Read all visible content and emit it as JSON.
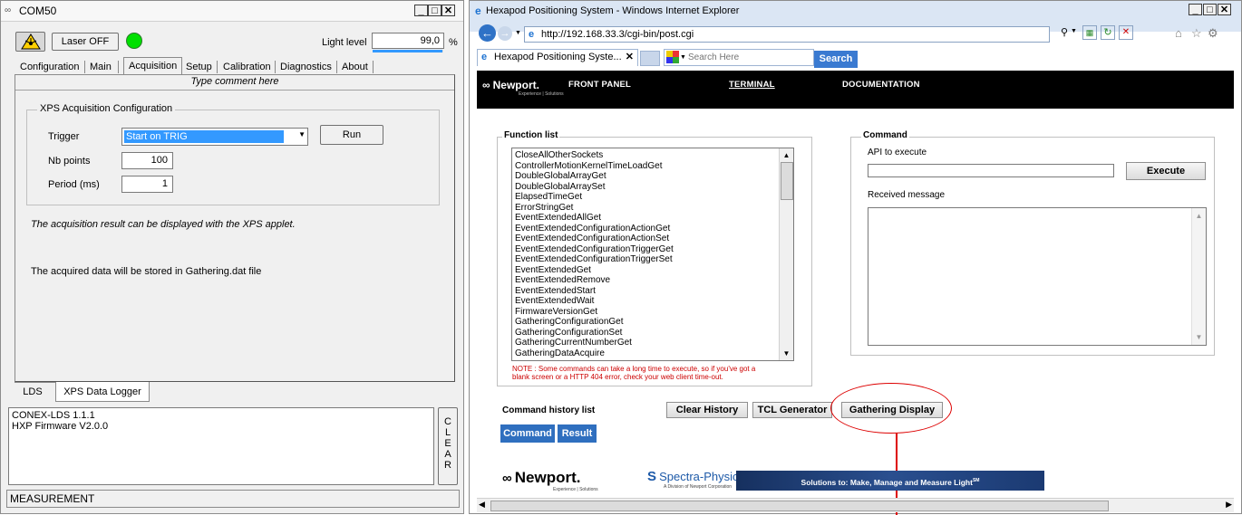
{
  "left": {
    "title": "COM50",
    "laser_button": "Laser OFF",
    "light_level_label": "Light level",
    "light_level_value": "99,0",
    "light_level_unit": "%",
    "tabs": [
      "Configuration",
      "Main",
      "Acquisition",
      "Setup",
      "Calibration",
      "Diagnostics",
      "About"
    ],
    "active_tab": "Acquisition",
    "comment": "Type comment here",
    "group_title": "XPS Acquisition Configuration",
    "trigger_label": "Trigger",
    "trigger_value": "Start on TRIG",
    "run_button": "Run",
    "nb_points_label": "Nb points",
    "nb_points_value": "100",
    "period_label": "Period (ms)",
    "period_value": "1",
    "note1": "The acquisition result can be displayed with the XPS applet.",
    "note2": "The acquired data will be stored in Gathering.dat file",
    "bottom_tabs": [
      "LDS",
      "XPS Data Logger"
    ],
    "log_lines": [
      "CONEX-LDS 1.1.1",
      "HXP Firmware V2.0.0"
    ],
    "clear_letters": [
      "C",
      "L",
      "E",
      "A",
      "R"
    ],
    "status": "MEASUREMENT",
    "colors": {
      "led": "#00e000",
      "light_bar": "#3399ff"
    }
  },
  "right": {
    "title": "Hexapod Positioning System - Windows Internet Explorer",
    "url": "http://192.168.33.3/cgi-bin/post.cgi",
    "tab_label": "Hexapod Positioning Syste...",
    "search_placeholder": "Search Here",
    "search_button": "Search",
    "nav": {
      "brand": "Newport.",
      "brand_sub": "Experience | Solutions",
      "front_panel": "FRONT PANEL",
      "terminal": "TERMINAL",
      "documentation": "DOCUMENTATION"
    },
    "function_list_title": "Function list",
    "functions": [
      "CloseAllOtherSockets",
      "ControllerMotionKernelTimeLoadGet",
      "DoubleGlobalArrayGet",
      "DoubleGlobalArraySet",
      "ElapsedTimeGet",
      "ErrorStringGet",
      "EventExtendedAllGet",
      "EventExtendedConfigurationActionGet",
      "EventExtendedConfigurationActionSet",
      "EventExtendedConfigurationTriggerGet",
      "EventExtendedConfigurationTriggerSet",
      "EventExtendedGet",
      "EventExtendedRemove",
      "EventExtendedStart",
      "EventExtendedWait",
      "FirmwareVersionGet",
      "GatheringConfigurationGet",
      "GatheringConfigurationSet",
      "GatheringCurrentNumberGet",
      "GatheringDataAcquire"
    ],
    "note_line1": "NOTE : Some commands can take a long time to execute, so if you've got a",
    "note_line2": "blank screen or a HTTP 404 error, check your web client time-out.",
    "command_title": "Command",
    "api_label": "API to execute",
    "execute_button": "Execute",
    "received_label": "Received message",
    "history_label": "Command history list",
    "clear_history": "Clear History",
    "tcl_generator": "TCL Generator",
    "gathering_display": "Gathering Display",
    "command_tab": "Command",
    "result_tab": "Result",
    "footer_newport": "Newport.",
    "footer_newport_sub": "Experience | Solutions",
    "footer_spectra": "Spectra-Physics",
    "footer_spectra_sub": "A Division of Newport Corporation",
    "footer_banner": "Solutions to: Make, Manage and Measure Light",
    "footer_banner_sup": "SM",
    "colors": {
      "navbar": "#000000",
      "blue_button": "#2f6fbf",
      "note": "#cc0000",
      "annotation": "#dd0000",
      "banner": "#1f3f7f"
    }
  }
}
